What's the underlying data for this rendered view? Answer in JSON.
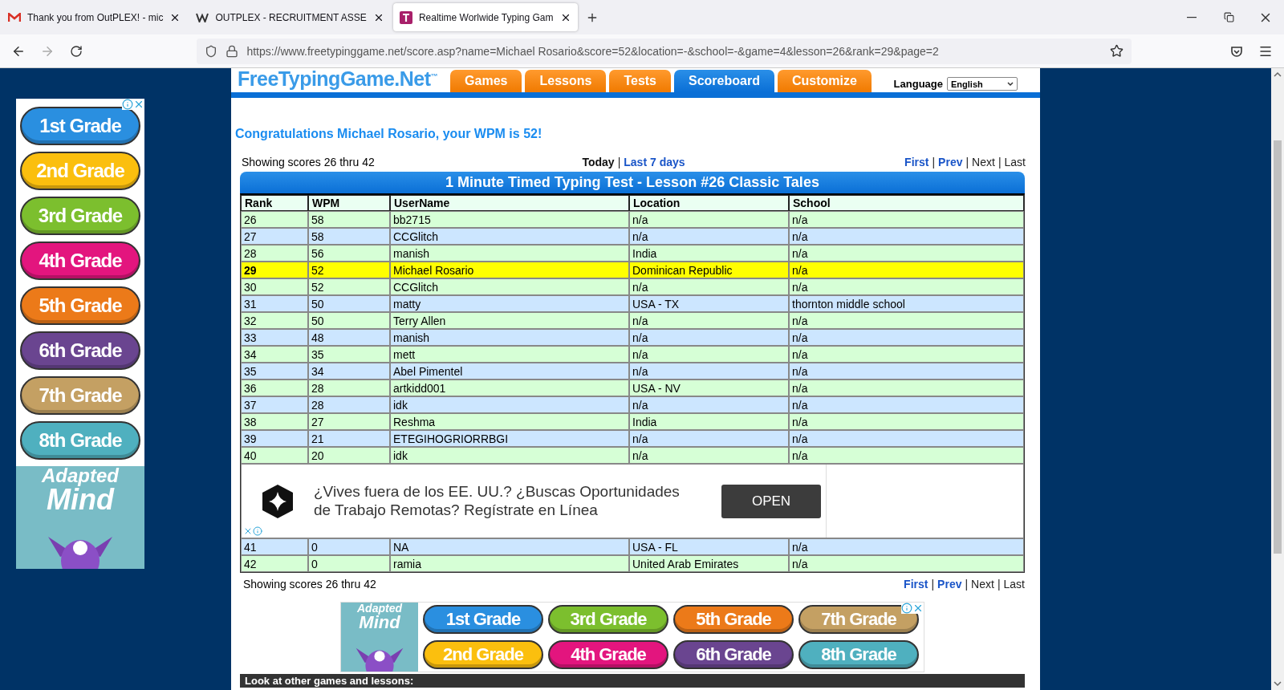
{
  "browser": {
    "tabs": [
      {
        "title": "Thank you from OutPLEX! - mic",
        "selected": false,
        "kind": "mail"
      },
      {
        "title": "OUTPLEX - RECRUITMENT ASSE",
        "selected": false,
        "kind": "w"
      },
      {
        "title": "Realtime Worlwide Typing Gam",
        "selected": true,
        "kind": "t"
      }
    ],
    "url": "https://www.freetypinggame.net/score.asp?name=Michael Rosario&score=52&location=-&school=-&game=4&lesson=26&rank=29&page=2"
  },
  "left_ad": {
    "grades": [
      {
        "label": "1st Grade",
        "color": "#2a8fe0"
      },
      {
        "label": "2nd Grade",
        "color": "#fbbf0e"
      },
      {
        "label": "3rd Grade",
        "color": "#7cbf2e"
      },
      {
        "label": "4th Grade",
        "color": "#e3157e"
      },
      {
        "label": "5th Grade",
        "color": "#ec7a19"
      },
      {
        "label": "6th Grade",
        "color": "#6a4590"
      },
      {
        "label": "7th Grade",
        "color": "#c4a063"
      },
      {
        "label": "8th Grade",
        "color": "#4fb0bf"
      }
    ],
    "brand": [
      "Adapted",
      "Mind"
    ]
  },
  "site": {
    "logo": "FreeTypingGame.Net$^{™}$",
    "nav": [
      {
        "label": "Games",
        "selected": false
      },
      {
        "label": "Lessons",
        "selected": false
      },
      {
        "label": "Tests",
        "selected": false
      },
      {
        "label": "Scoreboard",
        "selected": true
      },
      {
        "label": "Customize",
        "selected": false
      }
    ],
    "language": {
      "label": "Language",
      "value": "English"
    }
  },
  "congrats": "Congratulations Michael Rosario, your WPM is 52!",
  "separator": "|",
  "top_bar": {
    "showing": "Showing scores 26 thru 42",
    "periods": [
      {
        "label": "Today",
        "selected": true
      },
      {
        "label": "Last 7 days",
        "selected": false
      }
    ],
    "pager": [
      {
        "label": "First",
        "enabled": true
      },
      {
        "label": "Prev",
        "enabled": true
      },
      {
        "label": "Next",
        "enabled": false
      },
      {
        "label": "Last",
        "enabled": false
      }
    ]
  },
  "table": {
    "title": "1 Minute Timed Typing Test - Lesson #26 Classic Tales",
    "columns": [
      "Rank",
      "WPM",
      "UserName",
      "Location",
      "School"
    ],
    "rows": [
      {
        "cells": [
          "26",
          "58",
          "bb2715",
          "n/a",
          "n/a"
        ],
        "highlighted": false
      },
      {
        "cells": [
          "27",
          "58",
          "CCGlitch",
          "n/a",
          "n/a"
        ],
        "highlighted": false
      },
      {
        "cells": [
          "28",
          "56",
          "manish",
          "India",
          "n/a"
        ],
        "highlighted": false
      },
      {
        "cells": [
          "29",
          "52",
          "Michael Rosario",
          "Dominican Republic",
          "n/a"
        ],
        "highlighted": true
      },
      {
        "cells": [
          "30",
          "52",
          "CCGlitch",
          "n/a",
          "n/a"
        ],
        "highlighted": false
      },
      {
        "cells": [
          "31",
          "50",
          "matty",
          "USA - TX",
          "thornton middle school"
        ],
        "highlighted": false
      },
      {
        "cells": [
          "32",
          "50",
          "Terry Allen",
          "n/a",
          "n/a"
        ],
        "highlighted": false
      },
      {
        "cells": [
          "33",
          "48",
          "manish",
          "n/a",
          "n/a"
        ],
        "highlighted": false
      },
      {
        "cells": [
          "34",
          "35",
          "mett",
          "n/a",
          "n/a"
        ],
        "highlighted": false
      },
      {
        "cells": [
          "35",
          "34",
          "Abel Pimentel",
          "n/a",
          "n/a"
        ],
        "highlighted": false
      },
      {
        "cells": [
          "36",
          "28",
          "artkidd001",
          "USA - NV",
          "n/a"
        ],
        "highlighted": false
      },
      {
        "cells": [
          "37",
          "28",
          "idk",
          "n/a",
          "n/a"
        ],
        "highlighted": false
      },
      {
        "cells": [
          "38",
          "27",
          "Reshma",
          "India",
          "n/a"
        ],
        "highlighted": false
      },
      {
        "cells": [
          "39",
          "21",
          "ETEGIHOGRIORRBGI",
          "n/a",
          "n/a"
        ],
        "highlighted": false
      },
      {
        "cells": [
          "40",
          "20",
          "idk",
          "n/a",
          "n/a"
        ],
        "highlighted": false
      },
      {
        "kind": "ad",
        "text": "¿Vives fuera de los EE. UU.? ¿Buscas Oportunidades de Trabajo Remotas? Regístrate en Línea",
        "button": "OPEN"
      },
      {
        "cells": [
          "41",
          "0",
          "NA",
          "USA - FL",
          "n/a"
        ],
        "highlighted": false
      },
      {
        "cells": [
          "42",
          "0",
          "ramia",
          "United Arab Emirates",
          "n/a"
        ],
        "highlighted": false
      }
    ]
  },
  "bottom_bar": {
    "showing": "Showing scores 26 thru 42",
    "pager": [
      {
        "label": "First",
        "enabled": true
      },
      {
        "label": "Prev",
        "enabled": true
      },
      {
        "label": "Next",
        "enabled": false
      },
      {
        "label": "Last",
        "enabled": false
      }
    ]
  },
  "bottom_ad": {
    "brand": [
      "Adapted",
      "Mind"
    ],
    "grades": [
      {
        "label": "1st Grade",
        "color": "#2a8fe0"
      },
      {
        "label": "3rd Grade",
        "color": "#7cbf2e"
      },
      {
        "label": "5th Grade",
        "color": "#ec7a19"
      },
      {
        "label": "7th Grade",
        "color": "#c4a063"
      },
      {
        "label": "2nd Grade",
        "color": "#fbbf0e"
      },
      {
        "label": "4th Grade",
        "color": "#e3157e"
      },
      {
        "label": "6th Grade",
        "color": "#6a4590"
      },
      {
        "label": "8th Grade",
        "color": "#4fb0bf"
      }
    ]
  },
  "footer_heading": "Look at other games and lessons:"
}
